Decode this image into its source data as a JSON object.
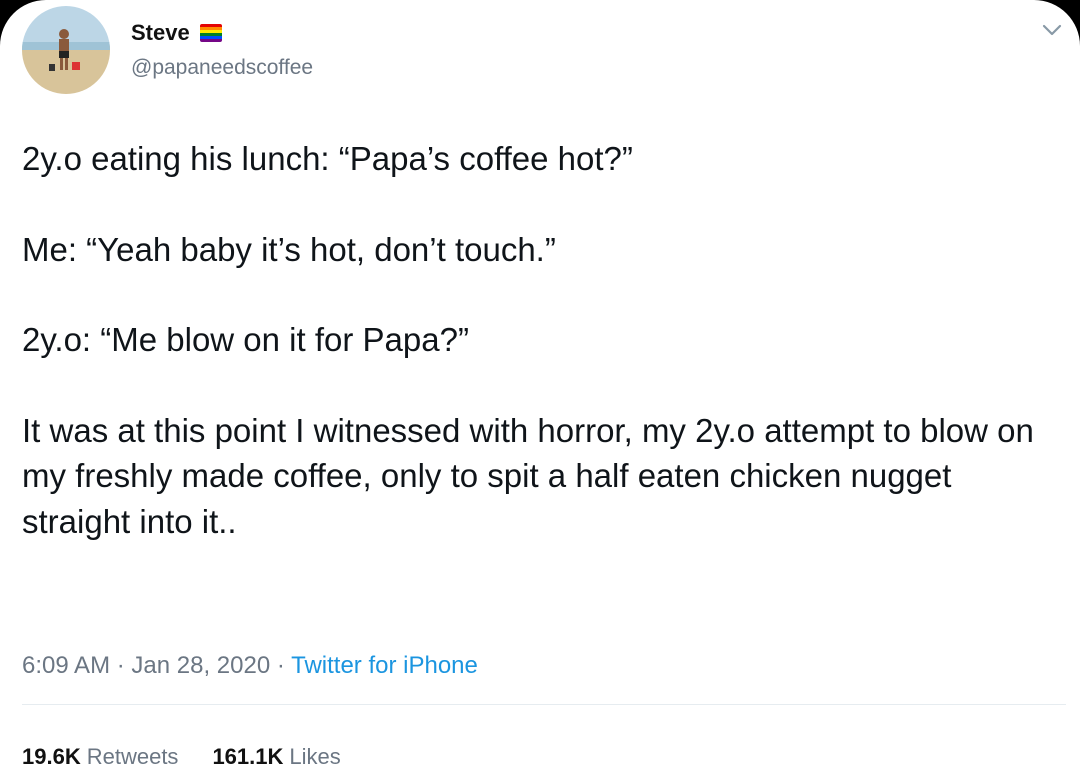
{
  "author": {
    "name": "Steve",
    "handle": "@papaneedscoffee",
    "flag_colors": [
      "#e40303",
      "#ff8c00",
      "#ffed00",
      "#008026",
      "#004dff",
      "#750787"
    ]
  },
  "tweet": {
    "paragraphs": [
      "2y.o eating his lunch: “Papa’s coffee hot?”",
      "Me: “Yeah baby it’s hot, don’t touch.”",
      "2y.o: “Me blow on it for Papa?”",
      "It was at this point I witnessed with horror, my 2y.o attempt to blow on my freshly made coffee, only to spit a half eaten chicken nugget straight into it.."
    ],
    "time": "6:09 AM",
    "date": "Jan 28, 2020",
    "source": "Twitter for iPhone"
  },
  "stats": {
    "retweets_count": "19.6K",
    "retweets_label": "Retweets",
    "likes_count": "161.1K",
    "likes_label": "Likes"
  },
  "colors": {
    "secondary_text": "#6b7683",
    "link": "#1b95e0"
  }
}
